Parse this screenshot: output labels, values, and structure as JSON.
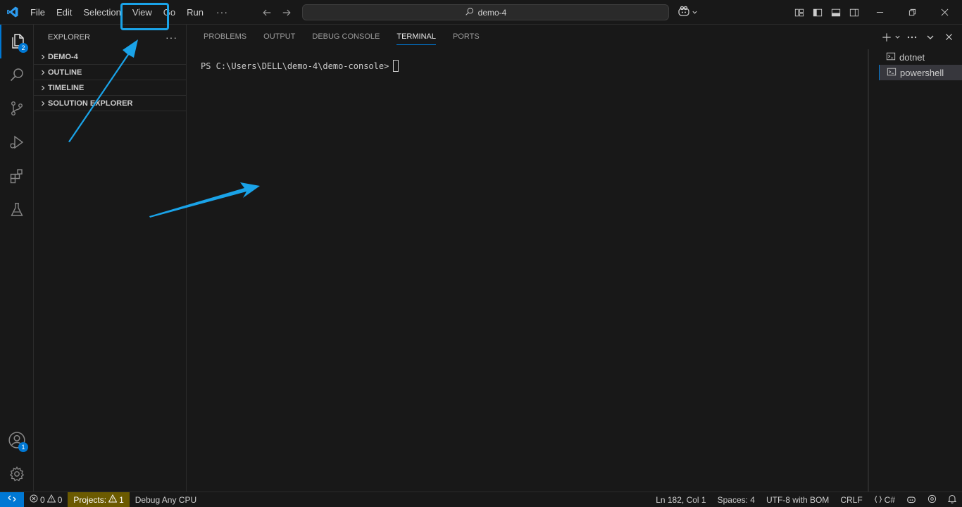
{
  "titlebar": {
    "menu": [
      "File",
      "Edit",
      "Selection",
      "View",
      "Go",
      "Run"
    ],
    "more_label": "···",
    "search_text": "demo-4"
  },
  "activitybar": {
    "explorer_badge": "2",
    "accounts_badge": "1"
  },
  "sidebar": {
    "title": "EXPLORER",
    "more_label": "···",
    "sections": [
      "DEMO-4",
      "OUTLINE",
      "TIMELINE",
      "SOLUTION EXPLORER"
    ]
  },
  "panel": {
    "tabs": [
      "PROBLEMS",
      "OUTPUT",
      "DEBUG CONSOLE",
      "TERMINAL",
      "PORTS"
    ],
    "active_tab": "TERMINAL",
    "prompt": "PS C:\\Users\\DELL\\demo-4\\demo-console>",
    "terminals": [
      "dotnet",
      "powershell"
    ],
    "selected_terminal": "powershell"
  },
  "statusbar": {
    "errors": "0",
    "warnings": "0",
    "projects_label": "Projects:",
    "projects_warnings": "1",
    "debug_config": "Debug Any CPU",
    "cursor_position": "Ln 182, Col 1",
    "spaces": "Spaces: 4",
    "encoding": "UTF-8 with BOM",
    "eol": "CRLF",
    "language": "C#"
  },
  "colors": {
    "accent": "#0078d4",
    "annotation": "#1aa3e8",
    "background": "#181818"
  }
}
